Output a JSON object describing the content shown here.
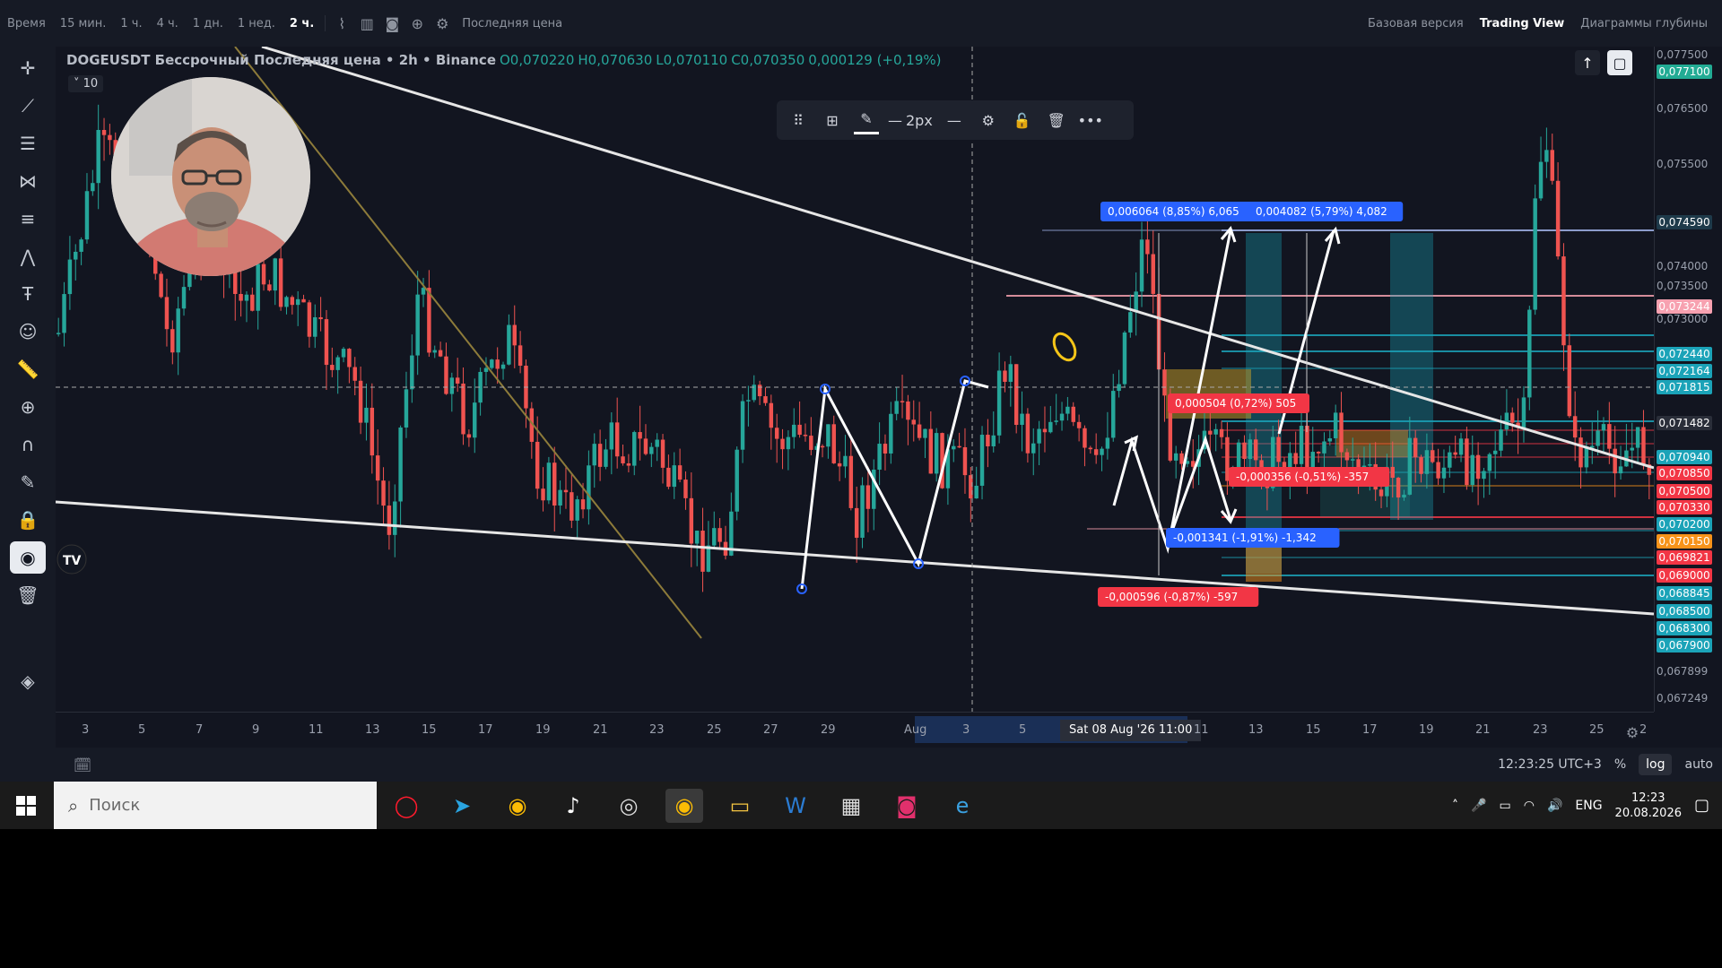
{
  "topbar": {
    "items": [
      "Время",
      "15 мин.",
      "1 ч.",
      "4 ч.",
      "1 дн.",
      "1 нед.",
      "2 ч."
    ],
    "active_interval": "2 ч.",
    "price_type": "Последняя цена",
    "right_links": [
      "Базовая версия",
      "Trading View",
      "Диаграммы глубины"
    ],
    "active_right": "Trading View"
  },
  "legend": {
    "symbol": "DOGEUSDT Бессрочный Последняя цена • 2h • Binance",
    "open": "O0,070220",
    "high": "H0,070630",
    "low": "L0,070110",
    "close": "C0,070350",
    "change": "0,000129 (+0,19%)",
    "collapse": "10"
  },
  "drawing_toolbar": {
    "width_label": "2px"
  },
  "price_scale": {
    "labels": [
      "0,077500",
      "0,076500",
      "0,075500",
      "0,074000",
      "0,073500",
      "0,073000",
      "0,067899",
      "0,067249"
    ],
    "tags": [
      {
        "text": "0,077100",
        "color": "#22ab94"
      },
      {
        "text": "0,074590",
        "color": "#1e3a4a"
      },
      {
        "text": "0,073244",
        "color": "#f7a1b0"
      },
      {
        "text": "0,072440",
        "color": "#1ba3b8"
      },
      {
        "text": "0,072164",
        "color": "#1ba3b8"
      },
      {
        "text": "0,071815",
        "color": "#1ba3b8"
      },
      {
        "text": "0,071482",
        "color": "#2a2e39"
      },
      {
        "text": "0,070940",
        "color": "#1ba3b8"
      },
      {
        "text": "0,070850",
        "color": "#f23645"
      },
      {
        "text": "0,070500",
        "color": "#f23645"
      },
      {
        "text": "0,070330",
        "color": "#f23645"
      },
      {
        "text": "0,070200",
        "color": "#1ba3b8"
      },
      {
        "text": "0,070150",
        "color": "#f7931a"
      },
      {
        "text": "0,069821",
        "color": "#f23645"
      },
      {
        "text": "0,069000",
        "color": "#f23645"
      },
      {
        "text": "0,068845",
        "color": "#1ba3b8"
      },
      {
        "text": "0,068500",
        "color": "#1ba3b8"
      },
      {
        "text": "0,068300",
        "color": "#1ba3b8"
      },
      {
        "text": "0,067900",
        "color": "#1ba3b8"
      }
    ]
  },
  "measurements": [
    {
      "text": "0,006064 (8,85%) 6,065",
      "color": "#2962ff"
    },
    {
      "text": "0,004082 (5,79%) 4,082",
      "color": "#2962ff"
    },
    {
      "text": "0,000504 (0,72%) 505",
      "color": "#f23645"
    },
    {
      "text": "-0,000356 (-0,51%) -357",
      "color": "#f23645"
    },
    {
      "text": "-0,001341 (-1,91%) -1,342",
      "color": "#2962ff"
    },
    {
      "text": "-0,000596 (-0,87%) -597",
      "color": "#f23645"
    }
  ],
  "time_axis": {
    "labels": [
      "3",
      "5",
      "7",
      "9",
      "11",
      "13",
      "15",
      "17",
      "19",
      "21",
      "23",
      "25",
      "27",
      "29",
      "Aug",
      "3",
      "5",
      "11",
      "13",
      "15",
      "17",
      "19",
      "21",
      "23",
      "25",
      "2"
    ],
    "crosshair": "Sat 08 Aug '26   11:00"
  },
  "bottombar": {
    "time": "12:23:25 UTC+3",
    "percent": "%",
    "log": "log",
    "auto": "auto"
  },
  "taskbar": {
    "search_placeholder": "Поиск",
    "lang": "ENG",
    "time": "12:23",
    "date": "20.08.2026"
  },
  "colors": {
    "up": "#26a69a",
    "down": "#ef5350",
    "background": "#121520"
  }
}
